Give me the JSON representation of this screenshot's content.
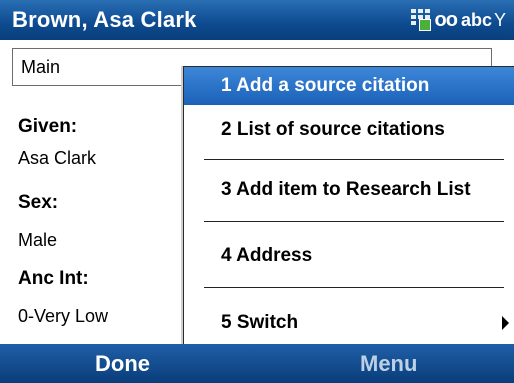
{
  "title_bar": {
    "title": "Brown, Asa Clark",
    "tray": {
      "icons": [
        "grid-check-icon",
        "oo-icon",
        "signal-icon"
      ],
      "input_mode": "abc"
    }
  },
  "field_select": {
    "value": "Main"
  },
  "details": [
    {
      "label": "Given:",
      "value": "Asa Clark"
    },
    {
      "label": "Sex:",
      "value": "Male"
    },
    {
      "label": "Anc Int:",
      "value": "0-Very Low"
    }
  ],
  "menu": {
    "items": [
      {
        "label": "1 Add a source citation",
        "selected": true
      },
      {
        "label": "2 List of source citations",
        "selected": false
      },
      {
        "label": "3 Add item to Research List",
        "selected": false
      },
      {
        "label": "4 Address",
        "selected": false
      },
      {
        "label": "5 Switch",
        "selected": false,
        "submenu_icon": "triangle-right-icon"
      }
    ]
  },
  "softkeys": {
    "left": "Done",
    "right": "Menu"
  },
  "colors": {
    "titlebar": "#0d4a8f",
    "selection": "#2a72c6",
    "softbar": "#0f4a8e"
  }
}
